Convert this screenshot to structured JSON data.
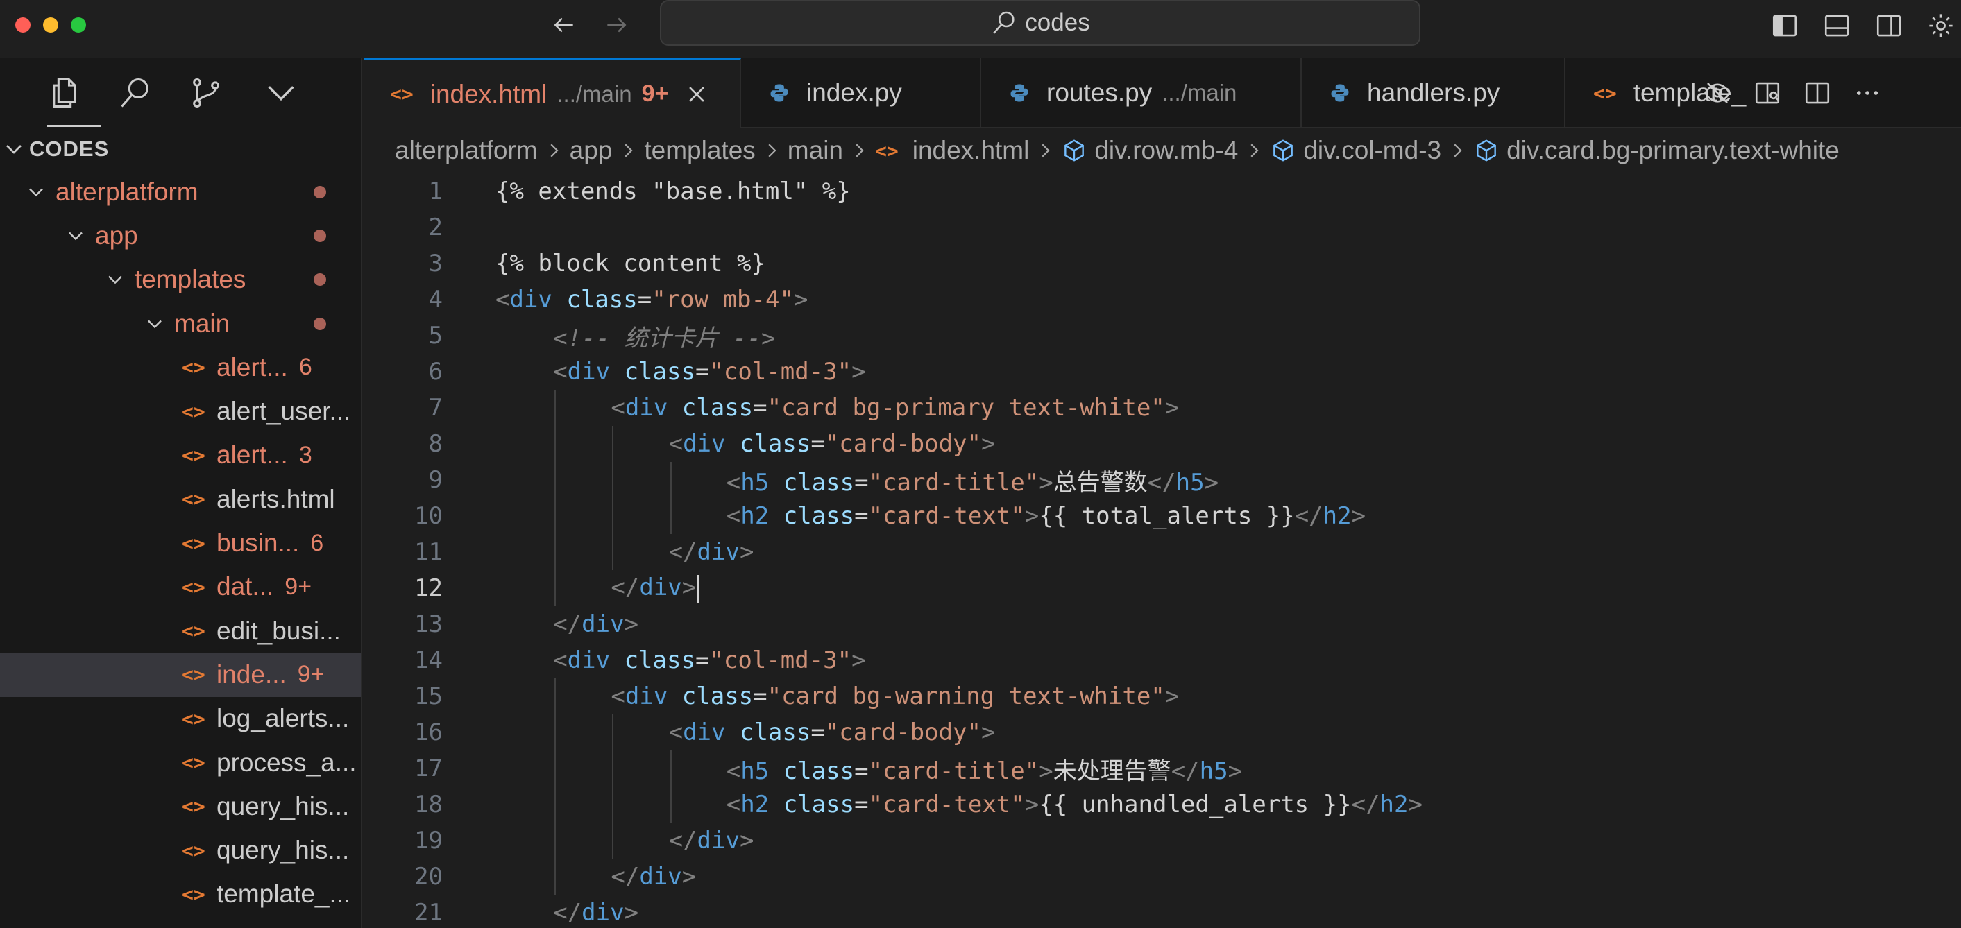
{
  "window": {
    "search_text": "codes",
    "icons": {
      "back": "arrow-left-icon",
      "forward": "arrow-right-icon",
      "search": "search-icon",
      "layout": [
        "toggle-primary-sidebar-icon",
        "toggle-panel-icon",
        "toggle-secondary-sidebar-icon",
        "customize-layout-icon"
      ]
    }
  },
  "sidebar": {
    "activity_icons": [
      "explorer-icon",
      "search-icon",
      "source-control-icon",
      "more-chevron-icon"
    ],
    "explorer_title": "CODES",
    "folders": {
      "root": "alterplatform",
      "app": "app",
      "templates": "templates",
      "main": "main"
    },
    "files": [
      {
        "name": "alert...",
        "badge": "6",
        "modified": true
      },
      {
        "name": "alert_user...",
        "badge": "",
        "modified": false
      },
      {
        "name": "alert...",
        "badge": "3",
        "modified": true
      },
      {
        "name": "alerts.html",
        "badge": "",
        "modified": false
      },
      {
        "name": "busin...",
        "badge": "6",
        "modified": true
      },
      {
        "name": "dat...",
        "badge": "9+",
        "modified": true
      },
      {
        "name": "edit_busi...",
        "badge": "",
        "modified": false
      },
      {
        "name": "inde...",
        "badge": "9+",
        "modified": true
      },
      {
        "name": "log_alerts...",
        "badge": "",
        "modified": false
      },
      {
        "name": "process_a...",
        "badge": "",
        "modified": false
      },
      {
        "name": "query_his...",
        "badge": "",
        "modified": false
      },
      {
        "name": "query_his...",
        "badge": "",
        "modified": false
      },
      {
        "name": "template_...",
        "badge": "",
        "modified": false
      }
    ],
    "html_icon_glyph": "<>"
  },
  "tabs": [
    {
      "name": "index.html",
      "desc": ".../main",
      "badge": "9+",
      "type": "html",
      "active": true
    },
    {
      "name": "index.py",
      "desc": "",
      "badge": "",
      "type": "python",
      "active": false
    },
    {
      "name": "routes.py",
      "desc": ".../main",
      "badge": "",
      "type": "python",
      "active": false
    },
    {
      "name": "handlers.py",
      "desc": "",
      "badge": "",
      "type": "python",
      "active": false
    },
    {
      "name": "template_",
      "desc": "",
      "badge": "",
      "type": "html",
      "active": false
    }
  ],
  "breadcrumb": {
    "items": [
      "alterplatform",
      "app",
      "templates",
      "main"
    ],
    "file": "index.html",
    "symbols": [
      "div.row.mb-4",
      "div.col-md-3",
      "div.card.bg-primary.text-white"
    ]
  },
  "editor": {
    "current_line": 12,
    "lines": [
      {
        "n": "1",
        "text": "{% extends \"base.html\" %}"
      },
      {
        "n": "2",
        "text": ""
      },
      {
        "n": "3",
        "text": "{% block content %}"
      },
      {
        "n": "4",
        "text": "<div class=\"row mb-4\">"
      },
      {
        "n": "5",
        "text": "<!-- 统计卡片 -->"
      },
      {
        "n": "6",
        "text": "<div class=\"col-md-3\">"
      },
      {
        "n": "7",
        "text": "<div class=\"card bg-primary text-white\">"
      },
      {
        "n": "8",
        "text": "<div class=\"card-body\">"
      },
      {
        "n": "9",
        "text": "<h5 class=\"card-title\">总告警数</h5>"
      },
      {
        "n": "10",
        "text": "<h2 class=\"card-text\">{{ total_alerts }}</h2>"
      },
      {
        "n": "11",
        "text": "</div>"
      },
      {
        "n": "12",
        "text": "</div>"
      },
      {
        "n": "13",
        "text": "</div>"
      },
      {
        "n": "14",
        "text": "<div class=\"col-md-3\">"
      },
      {
        "n": "15",
        "text": "<div class=\"card bg-warning text-white\">"
      },
      {
        "n": "16",
        "text": "<div class=\"card-body\">"
      },
      {
        "n": "17",
        "text": "<h5 class=\"card-title\">未处理告警</h5>"
      },
      {
        "n": "18",
        "text": "<h2 class=\"card-text\">{{ unhandled_alerts }}</h2>"
      },
      {
        "n": "19",
        "text": "</div>"
      },
      {
        "n": "20",
        "text": "</div>"
      },
      {
        "n": "21",
        "text": "</div>"
      }
    ]
  },
  "colors": {
    "modified": "#e2826a",
    "tag": "#569cd6",
    "attr": "#9cdcfe",
    "string": "#ce9178",
    "accent": "#0078d4"
  }
}
